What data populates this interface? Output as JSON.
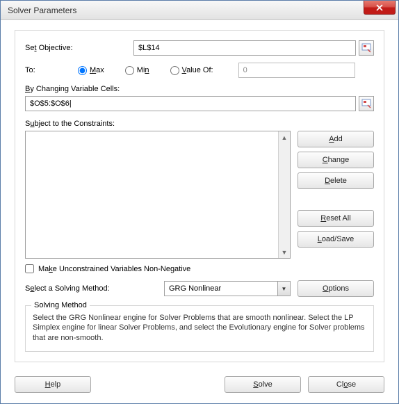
{
  "title": "Solver Parameters",
  "objective": {
    "label_pre": "Se",
    "label_u": "t",
    "label_post": " Objective:",
    "value": "$L$14"
  },
  "to": {
    "label": "To:",
    "max_u": "M",
    "max_post": "ax",
    "min_pre": "Mi",
    "min_u": "n",
    "valof_u": "V",
    "valof_post": "alue Of:",
    "value": "0",
    "selected": "max"
  },
  "variable_cells": {
    "label_u": "B",
    "label_post": "y Changing Variable Cells:",
    "value": "$O$5:$O$6|"
  },
  "constraints": {
    "label_pre": "S",
    "label_u": "u",
    "label_post": "bject to the Constraints:",
    "items": []
  },
  "side_buttons": {
    "add_u": "A",
    "add_post": "dd",
    "change_u": "C",
    "change_post": "hange",
    "delete_u": "D",
    "delete_post": "elete",
    "reset_u": "R",
    "reset_post": "eset All",
    "load_pre": "",
    "load_u": "L",
    "load_post": "oad/Save"
  },
  "unconstrained": {
    "label_pre": "Ma",
    "label_u": "k",
    "label_post": "e Unconstrained Variables Non-Negative",
    "checked": false
  },
  "method": {
    "label_pre": "S",
    "label_u": "e",
    "label_post": "lect a Solving Method:",
    "selected": "GRG Nonlinear",
    "options_u": "O",
    "options_post": "ptions"
  },
  "desc": {
    "title": "Solving Method",
    "text": "Select the GRG Nonlinear engine for Solver Problems that are smooth nonlinear. Select the LP Simplex engine for linear Solver Problems, and select the Evolutionary engine for Solver problems that are non-smooth."
  },
  "bottom": {
    "help_u": "H",
    "help_post": "elp",
    "solve_u": "S",
    "solve_post": "olve",
    "close_pre": "Cl",
    "close_u": "o",
    "close_post": "se"
  }
}
